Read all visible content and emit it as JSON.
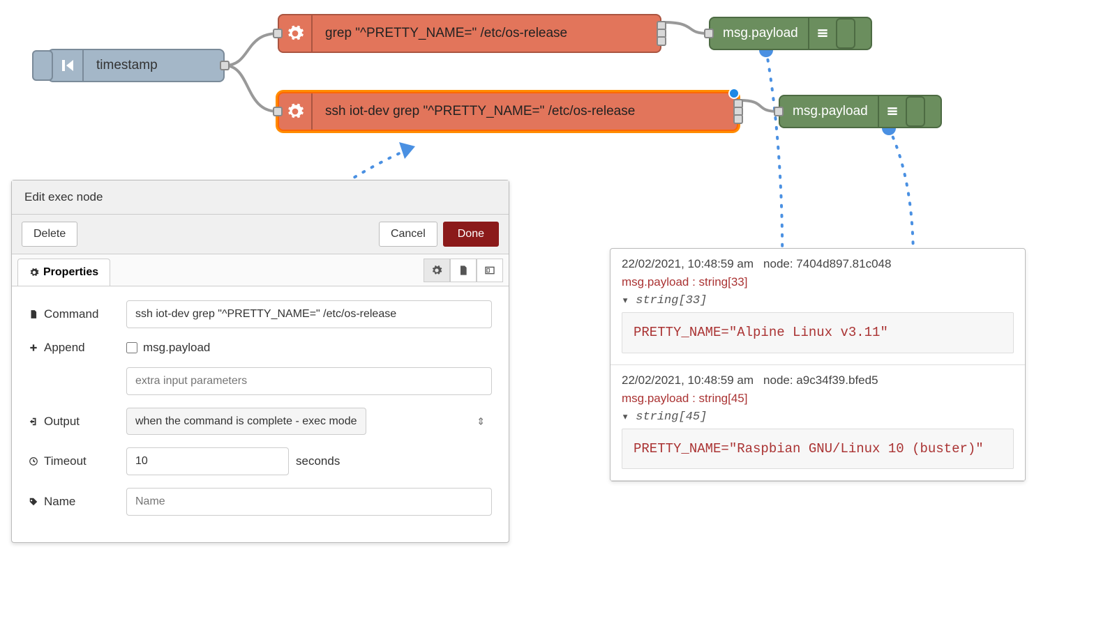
{
  "nodes": {
    "inject": {
      "label": "timestamp"
    },
    "exec1": {
      "label": "grep \"^PRETTY_NAME=\" /etc/os-release"
    },
    "exec2": {
      "label": "ssh iot-dev grep \"^PRETTY_NAME=\" /etc/os-release"
    },
    "debug1": {
      "label": "msg.payload"
    },
    "debug2": {
      "label": "msg.payload"
    }
  },
  "editor": {
    "title": "Edit exec node",
    "delete": "Delete",
    "cancel": "Cancel",
    "done": "Done",
    "tab_properties": "Properties",
    "fields": {
      "command_label": "Command",
      "command_value": "ssh iot-dev grep \"^PRETTY_NAME=\" /etc/os-release",
      "append_label": "Append",
      "append_checkbox_label": "msg.payload",
      "append_extra_placeholder": "extra input parameters",
      "output_label": "Output",
      "output_value": "when the command is complete - exec mode",
      "timeout_label": "Timeout",
      "timeout_value": "10",
      "timeout_suffix": "seconds",
      "name_label": "Name",
      "name_placeholder": "Name"
    }
  },
  "debug": {
    "messages": [
      {
        "timestamp": "22/02/2021, 10:48:59 am",
        "node": "node: 7404d897.81c048",
        "topic": "msg.payload : string[33]",
        "type": "string[33]",
        "value": "PRETTY_NAME=\"Alpine Linux v3.11\""
      },
      {
        "timestamp": "22/02/2021, 10:48:59 am",
        "node": "node: a9c34f39.bfed5",
        "topic": "msg.payload : string[45]",
        "type": "string[45]",
        "value": "PRETTY_NAME=\"Raspbian GNU/Linux 10 (buster)\""
      }
    ]
  }
}
